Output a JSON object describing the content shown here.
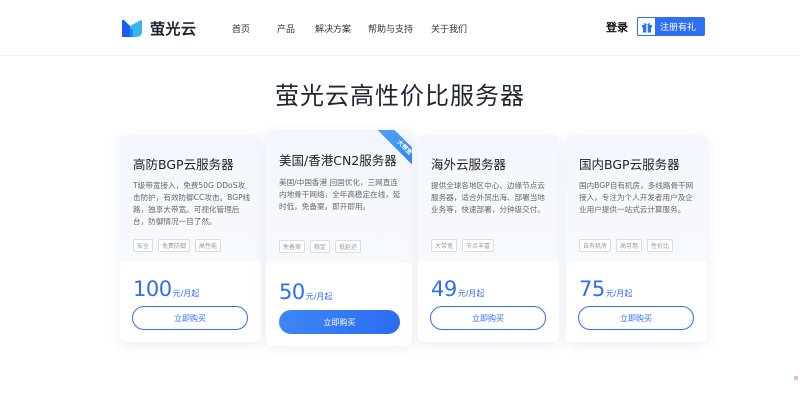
{
  "header": {
    "brand": "萤光云",
    "nav": [
      "首页",
      "产品",
      "解决方案",
      "帮助与支持",
      "关于我们"
    ],
    "login": "登录",
    "register": "注册有礼"
  },
  "title": "萤光云高性价比服务器",
  "cards": [
    {
      "name": "高防BGP云服务器",
      "desc": "T级带宽接入，免费50G DDoS攻击防护，有效防御CC攻击。BGP线路，独享大带宽。可视化管理后台，防御情况一目了然。",
      "tags": [
        "安全",
        "免费防御",
        "高性能"
      ],
      "price": "100",
      "unit": "元/月起",
      "button": "立即购买"
    },
    {
      "name": "美国/香港CN2服务器",
      "ribbon": "大带宽",
      "desc": "美国/中国香港 回国优化，三网直连内地骨干网络，全年高稳定在线，延时低，免备案，即开即用。",
      "tags": [
        "免备案",
        "稳定",
        "低延迟"
      ],
      "price": "50",
      "unit": "元/月起",
      "button": "立即购买"
    },
    {
      "name": "海外云服务器",
      "desc": "提供全球各地区中心、边缘节点云服务器，适合外贸出海、部署当地业务等，快速部署，分钟级交付。",
      "tags": [
        "大带宽",
        "节点丰富"
      ],
      "price": "49",
      "unit": "元/月起",
      "button": "立即购买"
    },
    {
      "name": "国内BGP云服务器",
      "desc": "国内BGP自有机房，多线路骨干网接入，专注为个人开发者用户及企业用户提供一站式云计算服务。",
      "tags": [
        "自有机房",
        "高可用",
        "性价比"
      ],
      "price": "75",
      "unit": "元/月起",
      "button": "立即购买"
    }
  ],
  "colors": {
    "accent": "#2f6ff3",
    "title": "#1f2533"
  },
  "icons": {
    "logo": "firefly-logo-icon",
    "gift": "gift-icon"
  }
}
